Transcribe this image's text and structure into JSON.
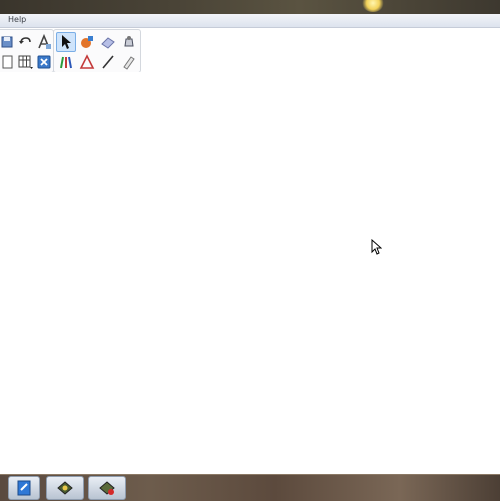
{
  "menu": {
    "help_label": "Help"
  },
  "toolbar": {
    "groups": [
      {
        "name": "file-tools",
        "tools": [
          "save-icon",
          "undo-icon",
          "font-icon",
          "new-page-icon",
          "table-icon",
          "close-icon"
        ]
      },
      {
        "name": "drawing-tools",
        "tools": [
          "select-arrow-icon",
          "fill-icon",
          "eraser-icon",
          "paint-bucket-icon",
          "pens-icon",
          "shape-icon",
          "line-icon",
          "highlighter-icon"
        ],
        "active": "select-arrow-icon"
      }
    ]
  },
  "taskbar": {
    "buttons": [
      "notepad-icon",
      "app-icon",
      "whiteboard-app-icon"
    ]
  },
  "colors": {
    "menubar": "#dde3ee",
    "active_tool": "#cfe4fb",
    "canvas": "#ffffff"
  }
}
